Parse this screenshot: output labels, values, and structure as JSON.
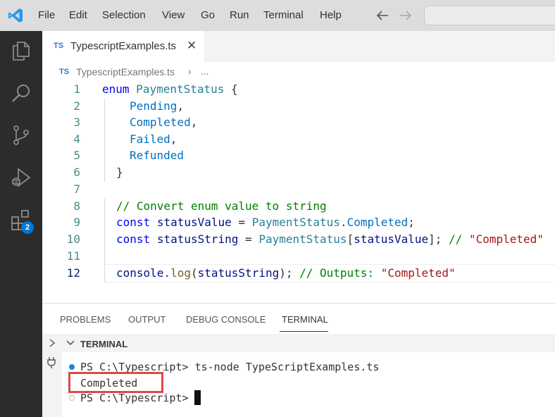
{
  "menu": {
    "file": "File",
    "edit": "Edit",
    "selection": "Selection",
    "view": "View",
    "go": "Go",
    "run": "Run",
    "terminal": "Terminal",
    "help": "Help",
    "back_icon": "arrow-left-icon",
    "forward_icon": "arrow-right-icon"
  },
  "activity_bar": {
    "extensions_badge": "2"
  },
  "tab": {
    "badge": "TS",
    "name": "TypescriptExamples.ts",
    "close_glyph": "✕"
  },
  "breadcrumb": {
    "badge": "TS",
    "file": "TypescriptExamples.ts",
    "separator": "›",
    "more": "..."
  },
  "editor": {
    "line_numbers": [
      "1",
      "2",
      "3",
      "4",
      "5",
      "6",
      "7",
      "8",
      "9",
      "10",
      "11",
      "12"
    ],
    "current_line": 12,
    "lines": {
      "l1": {
        "kw": "enum",
        "name": "PaymentStatus",
        "brace": "{"
      },
      "l2": {
        "member": "Pending",
        "punct": ","
      },
      "l3": {
        "member": "Completed",
        "punct": ","
      },
      "l4": {
        "member": "Failed",
        "punct": ","
      },
      "l5": {
        "member": "Refunded"
      },
      "l6": {
        "brace": "}"
      },
      "l8": {
        "comment": "// Convert enum value to string"
      },
      "l9": {
        "kw": "const",
        "var": "statusValue",
        "op": "=",
        "obj": "PaymentStatus",
        "dot": ".",
        "prop": "Completed",
        "semi": ";"
      },
      "l10": {
        "kw": "const",
        "var": "statusString",
        "op": "=",
        "obj": "PaymentStatus",
        "lb": "[",
        "idx": "statusValue",
        "rb": "];",
        "comment": "//",
        "string": "\"Completed\""
      },
      "l12": {
        "obj": "console",
        "dot": ".",
        "fn": "log",
        "lp": "(",
        "arg": "statusString",
        "rp": ");",
        "comment": "// Outputs:",
        "string": "\"Completed\""
      }
    }
  },
  "panel": {
    "tabs": [
      "PROBLEMS",
      "OUTPUT",
      "DEBUG CONSOLE",
      "TERMINAL"
    ],
    "active_tab": "TERMINAL",
    "terminal_header": "TERMINAL",
    "terminal": {
      "prompt1": "PS C:\\Typescript>",
      "command1": "ts-node TypeScriptExamples.ts",
      "output": "Completed",
      "prompt2": "PS C:\\Typescript>"
    }
  },
  "colors": {
    "activity_bar": "#2c2c2c",
    "title_bar": "#dddddd",
    "accent": "#0078d4",
    "highlight_box": "#e0474a"
  }
}
